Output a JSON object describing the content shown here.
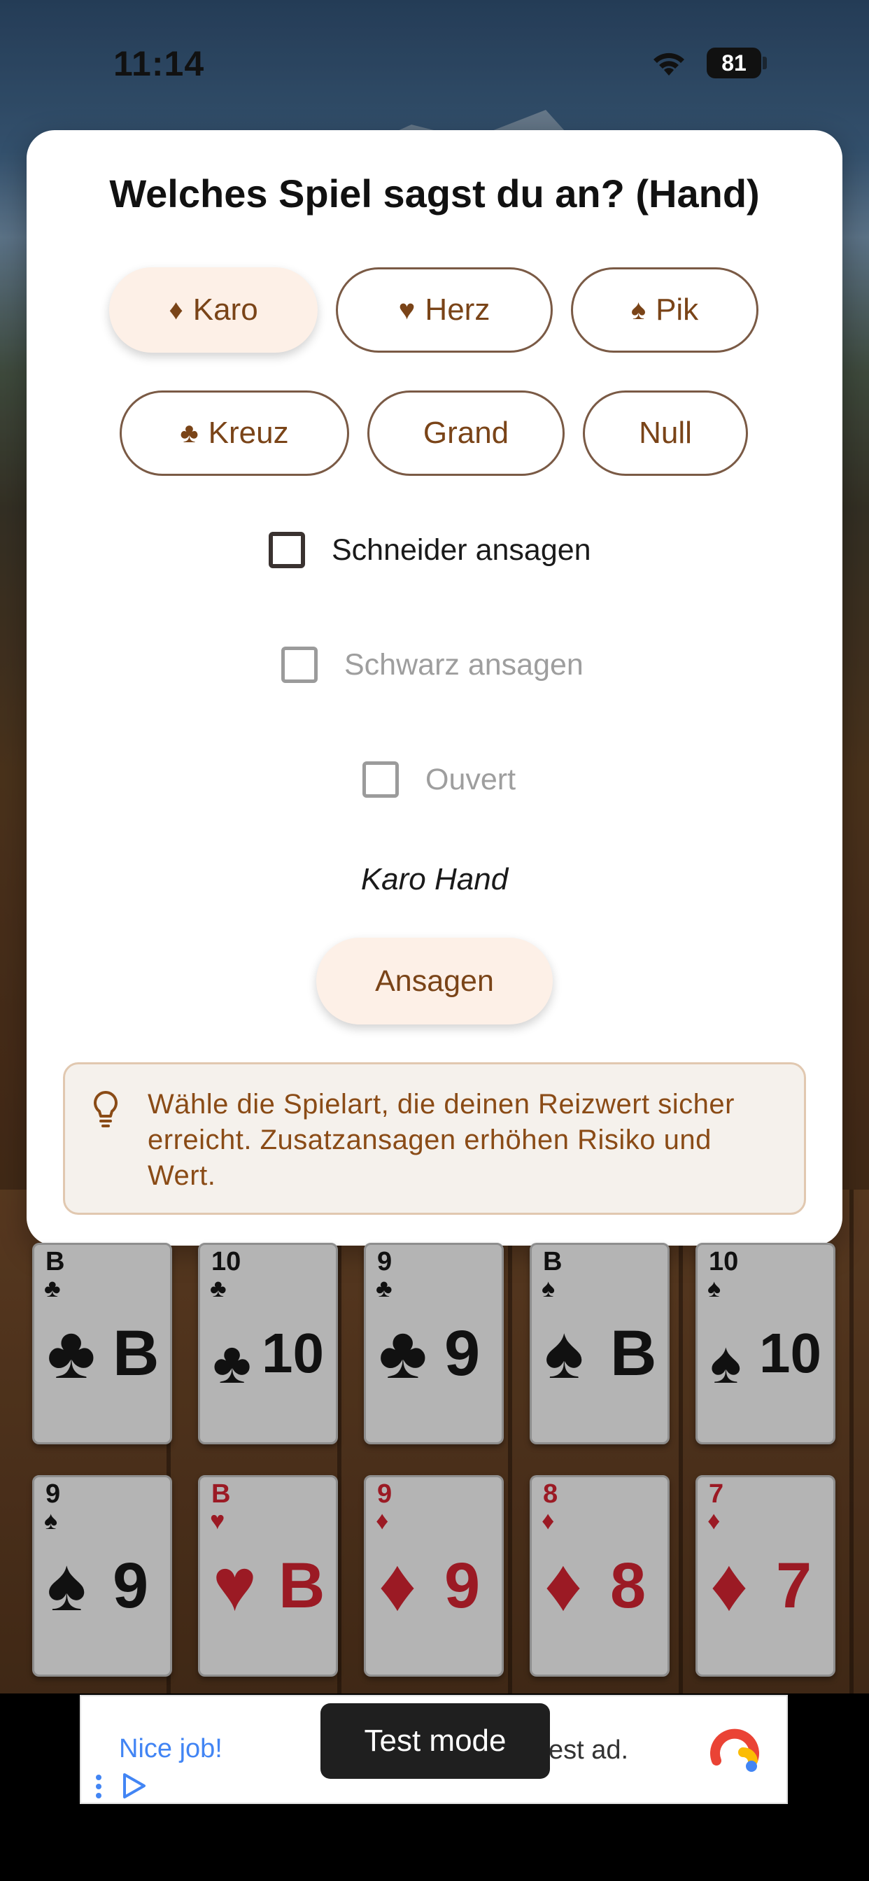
{
  "status_bar": {
    "time": "11:14",
    "battery": "81"
  },
  "dialog": {
    "title": "Welches Spiel sagst du an? (Hand)",
    "game_options": [
      {
        "label": "Karo",
        "suit": "♦",
        "selected": true
      },
      {
        "label": "Herz",
        "suit": "♥",
        "selected": false
      },
      {
        "label": "Pik",
        "suit": "♠",
        "selected": false
      },
      {
        "label": "Kreuz",
        "suit": "♣",
        "selected": false
      },
      {
        "label": "Grand",
        "suit": "",
        "selected": false
      },
      {
        "label": "Null",
        "suit": "",
        "selected": false
      }
    ],
    "options": [
      {
        "label": "Schneider ansagen",
        "checked": false,
        "enabled": true
      },
      {
        "label": "Schwarz ansagen",
        "checked": false,
        "enabled": false
      },
      {
        "label": "Ouvert",
        "checked": false,
        "enabled": false
      }
    ],
    "summary": "Karo Hand",
    "announce_label": "Ansagen",
    "hint": "Wähle die Spielart, die deinen Reizwert sicher erreicht. Zusatzansagen erhöhen Risiko und Wert.",
    "hint_icon": "lightbulb-icon"
  },
  "hand": [
    {
      "rank": "B",
      "suit": "♣",
      "color": "black"
    },
    {
      "rank": "10",
      "suit": "♣",
      "color": "black"
    },
    {
      "rank": "9",
      "suit": "♣",
      "color": "black"
    },
    {
      "rank": "B",
      "suit": "♠",
      "color": "black"
    },
    {
      "rank": "10",
      "suit": "♠",
      "color": "black"
    },
    {
      "rank": "9",
      "suit": "♠",
      "color": "black"
    },
    {
      "rank": "B",
      "suit": "♥",
      "color": "red"
    },
    {
      "rank": "9",
      "suit": "♦",
      "color": "red"
    },
    {
      "rank": "8",
      "suit": "♦",
      "color": "red"
    },
    {
      "rank": "7",
      "suit": "♦",
      "color": "red"
    }
  ],
  "ad": {
    "headline": "Nice job!",
    "text_fragment": "est ad.",
    "toast": "Test mode"
  },
  "colors": {
    "accent": "#7a4418",
    "selected_bg": "#fdf0e7",
    "red_suit": "#9b1a24"
  }
}
